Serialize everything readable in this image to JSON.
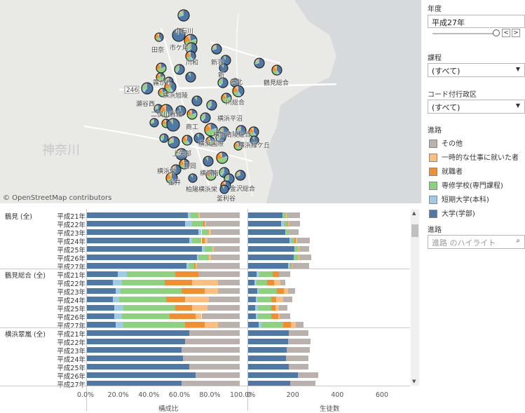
{
  "map": {
    "credit": "© OpenStreetMap contributors",
    "road_label": "246",
    "region_label": "神奈川",
    "labels": [
      "小石川",
      "田奈",
      "市ケ尾",
      "川和",
      "新羽",
      "新",
      "港北",
      "鶴見総合",
      "霧が丘",
      "横浜旭陵",
      "瀬谷西",
      "川総合",
      "二俣川看護",
      "横浜平沼",
      "商工",
      "横浜清陵総合",
      "上矢部",
      "横浜国際",
      "横浜緑ケ丘",
      "舞岡",
      "横浜南",
      "横浜栄",
      "金井",
      "柏陽横浜栄",
      "金沢総合",
      "釜利谷"
    ]
  },
  "panel": {
    "year_title": "年度",
    "year_value": "平成27年",
    "course_title": "課程",
    "course_value": "(すべて)",
    "district_title": "コード付行政区",
    "district_value": "(すべて)",
    "legend_title": "進路",
    "legend": [
      {
        "label": "その他",
        "color": "#bab0ac"
      },
      {
        "label": "一時的な仕事に就いた者",
        "color": "#ffbe7d"
      },
      {
        "label": "就職者",
        "color": "#f28e2b"
      },
      {
        "label": "専修学校(専門課程)",
        "color": "#8cd17d"
      },
      {
        "label": "短期大学(本科)",
        "color": "#a0cbe8"
      },
      {
        "label": "大学(学部)",
        "color": "#4e79a7"
      }
    ],
    "highlight_title": "進路",
    "highlight_placeholder": "進路 のハイライト"
  },
  "chart_data": [
    {
      "type": "bar",
      "title": "",
      "xlabel": "構成比",
      "xticks": [
        "0.0%",
        "20.0%",
        "40.0%",
        "60.0%",
        "80.0%",
        "100.0%"
      ],
      "xlim": [
        0,
        100
      ],
      "series_order": [
        "大学(学部)",
        "短期大学(本科)",
        "専修学校(専門課程)",
        "就職者",
        "一時的な仕事に就いた者",
        "その他"
      ],
      "groups": [
        {
          "name": "鶴見 (全)",
          "rows": [
            {
              "year": "平成21年",
              "values": [
                66,
                2,
                5,
                0,
                1,
                26
              ]
            },
            {
              "year": "平成22年",
              "values": [
                64,
                5,
                7,
                1,
                1,
                22
              ]
            },
            {
              "year": "平成23年",
              "values": [
                73,
                2,
                5,
                0,
                1,
                19
              ]
            },
            {
              "year": "平成24年",
              "values": [
                67,
                2,
                6,
                2,
                2,
                21
              ]
            },
            {
              "year": "平成25年",
              "values": [
                75,
                2,
                5,
                0,
                1,
                17
              ]
            },
            {
              "year": "平成26年",
              "values": [
                72,
                1,
                7,
                0,
                1,
                19
              ]
            },
            {
              "year": "平成27年",
              "values": [
                65,
                2,
                3,
                1,
                1,
                28
              ]
            }
          ]
        },
        {
          "name": "鶴見総合 (全)",
          "rows": [
            {
              "year": "平成21年",
              "values": [
                20,
                6,
                32,
                15,
                0,
                27
              ]
            },
            {
              "year": "平成22年",
              "values": [
                17,
                6,
                28,
                18,
                17,
                14
              ]
            },
            {
              "year": "平成23年",
              "values": [
                19,
                3,
                40,
                15,
                9,
                14
              ]
            },
            {
              "year": "平成24年",
              "values": [
                17,
                4,
                31,
                12,
                16,
                20
              ]
            },
            {
              "year": "平成25年",
              "values": [
                18,
                6,
                34,
                11,
                10,
                21
              ]
            },
            {
              "year": "平成26年",
              "values": [
                18,
                5,
                31,
                17,
                4,
                25
              ]
            },
            {
              "year": "平成27年",
              "values": [
                19,
                5,
                40,
                13,
                9,
                14
              ]
            }
          ]
        },
        {
          "name": "横浜翠嵐 (全)",
          "rows": [
            {
              "year": "平成21年",
              "values": [
                67,
                0,
                0,
                0,
                0,
                33
              ]
            },
            {
              "year": "平成22年",
              "values": [
                64,
                0,
                0,
                0,
                0,
                36
              ]
            },
            {
              "year": "平成23年",
              "values": [
                62,
                0,
                0,
                0,
                0,
                38
              ]
            },
            {
              "year": "平成24年",
              "values": [
                63,
                0,
                0,
                0,
                0,
                37
              ]
            },
            {
              "year": "平成25年",
              "values": [
                67,
                0,
                0,
                0,
                0,
                33
              ]
            },
            {
              "year": "平成26年",
              "values": [
                71,
                0,
                0,
                0,
                0,
                29
              ]
            },
            {
              "year": "平成27年",
              "values": [
                62,
                0,
                0,
                0,
                0,
                38
              ]
            }
          ]
        }
      ]
    },
    {
      "type": "bar",
      "title": "",
      "xlabel": "生徒数",
      "xticks": [
        "0",
        "200",
        "400",
        "600"
      ],
      "xlim": [
        0,
        720
      ],
      "groups": [
        {
          "name": "鶴見 (全)",
          "totals": [
            233,
            232,
            227,
            277,
            275,
            282,
            275
          ]
        },
        {
          "name": "鶴見総合 (全)",
          "totals": [
            190,
            167,
            210,
            198,
            177,
            190,
            248
          ]
        },
        {
          "name": "横浜翠嵐 (全)",
          "totals": [
            270,
            280,
            277,
            270,
            270,
            313,
            302
          ]
        }
      ]
    }
  ]
}
